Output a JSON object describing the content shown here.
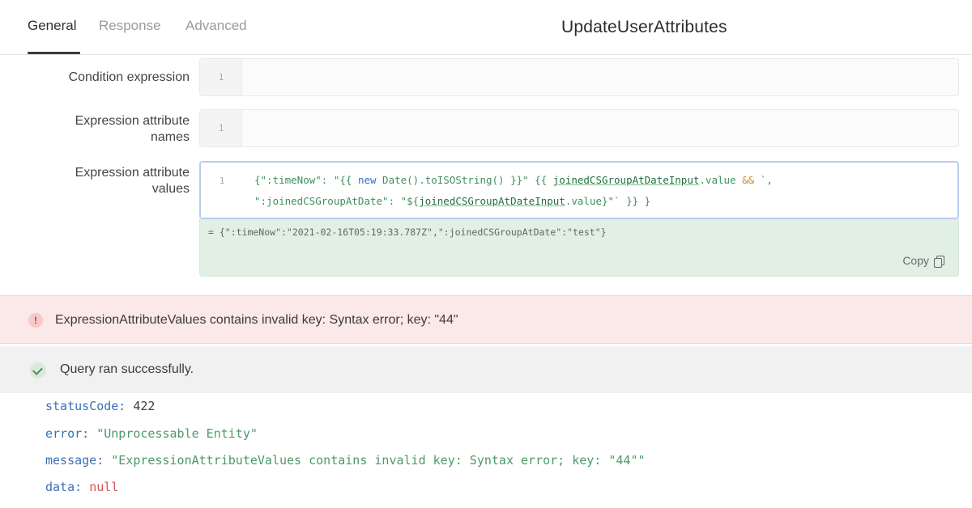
{
  "tabs": [
    {
      "label": "General",
      "active": true
    },
    {
      "label": "Response",
      "active": false
    },
    {
      "label": "Advanced",
      "active": false
    }
  ],
  "query_title": "UpdateUserAttributes",
  "fields": {
    "condition": {
      "label": "Condition expression",
      "line": "1",
      "value": ""
    },
    "names": {
      "label_line1": "Expression attribute",
      "label_line2": "names",
      "line": "1",
      "value": ""
    },
    "values": {
      "label_line1": "Expression attribute",
      "label_line2": "values",
      "line": "1",
      "code": {
        "l1_a": "{\":timeNow\": \"{{ ",
        "l1_kw": "new",
        "l1_b": " Date().toISOString() }}\" {{ ",
        "l1_var": "joinedCSGroupAtDateInput",
        "l1_c": ".value ",
        "l1_amp": "&&",
        "l1_d": " `,",
        "l2_a": "\":joinedCSGroupAtDate\": \"${",
        "l2_var": "joinedCSGroupAtDateInput",
        "l2_b": ".value}\"` }} }"
      },
      "preview": "= {\":timeNow\":\"2021-02-16T05:19:33.787Z\",\":joinedCSGroupAtDate\":\"test\"}",
      "copy_label": "Copy"
    }
  },
  "error": {
    "icon": "!",
    "message": "ExpressionAttributeValues contains invalid key: Syntax error; key: \"44\""
  },
  "success": {
    "message": "Query ran successfully."
  },
  "response": {
    "statusCode_key": "statusCode:",
    "statusCode_val": "422",
    "error_key": "error:",
    "error_val": "\"Unprocessable Entity\"",
    "message_key": "message:",
    "message_val": "\"ExpressionAttributeValues contains invalid key: Syntax error; key: \"44\"\"",
    "data_key": "data:",
    "data_val": "null"
  },
  "colors": {
    "error_bg": "#fbe8e8",
    "success_bg": "#f1f1f1",
    "preview_bg": "#e2efe4",
    "key_blue": "#3b6fb6",
    "string_green": "#4b9a66",
    "null_red": "#d9534f"
  }
}
